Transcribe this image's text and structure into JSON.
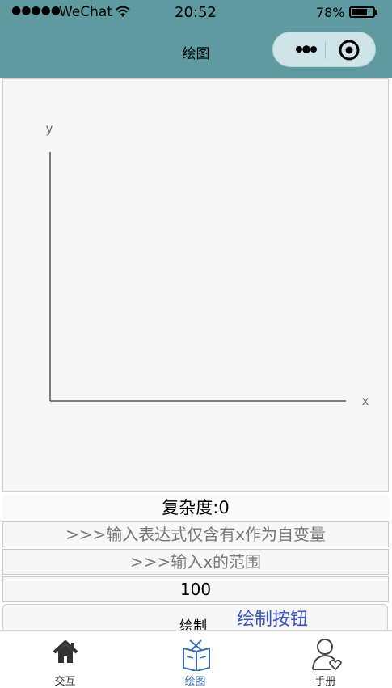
{
  "status_bar": {
    "signal": "●●●●●",
    "carrier": "WeChat",
    "time": "20:52",
    "battery": "78%",
    "battery_level": 0.78
  },
  "nav": {
    "title": "绘图",
    "icons": [
      "more-dots-icon",
      "close-circle-icon"
    ]
  },
  "plot": {
    "y_label": "y",
    "x_label": "x"
  },
  "form": {
    "complexity": "复杂度:0",
    "expression_placeholder": ">>>输入表达式仅含有x作为自变量",
    "range_placeholder": ">>>输入x的范围",
    "range_value": "100",
    "draw_label": "绘制",
    "annotation": "绘制按钮"
  },
  "tabbar": {
    "items": [
      {
        "label": "交互",
        "icon": "home-icon"
      },
      {
        "label": "绘图",
        "icon": "drawing-book-icon",
        "active": true
      },
      {
        "label": "手册",
        "icon": "user-heart-icon"
      }
    ]
  },
  "colors": {
    "nav_bg": "#5e9aa0",
    "annotation": "#3a56c6",
    "active_tab": "#3a6fb0"
  }
}
